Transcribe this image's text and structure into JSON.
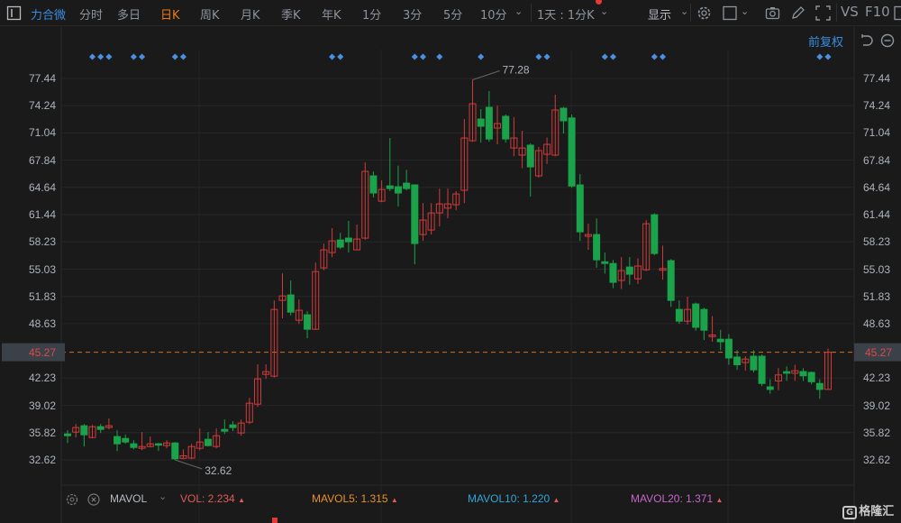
{
  "toolbar": {
    "stock_name": "力合微",
    "periods": [
      "分时",
      "多日",
      "日K",
      "周K",
      "月K",
      "季K",
      "年K",
      "1分",
      "3分",
      "5分",
      "10分"
    ],
    "active_period": "日K",
    "interval_select": "1天 : 1分K",
    "display_menu": "显示",
    "vs": "VS",
    "f10": "F10"
  },
  "sub_toolbar": {
    "adjust_mode": "前复权"
  },
  "indicator_bar": {
    "name": "MAVOL",
    "items": [
      {
        "label": "VOL: 2.234",
        "color": "#e05a5a"
      },
      {
        "label": "MAVOL5: 1.315",
        "color": "#e8902c"
      },
      {
        "label": "MAVOL10: 1.220",
        "color": "#2fa6d9"
      },
      {
        "label": "MAVOL20: 1.371",
        "color": "#c766c9"
      }
    ],
    "up_arrow": "▲"
  },
  "watermark": "格隆汇",
  "colors": {
    "accent": "#3b8de0",
    "active": "#f07a16",
    "up": "#d23a3a",
    "down": "#1aa34a",
    "current_line": "#d0702a",
    "marker": "#4a90e2"
  },
  "chart_data": {
    "type": "candlestick",
    "title": "力合微 日K",
    "y_ticks": [
      "77.44",
      "74.24",
      "71.04",
      "67.84",
      "64.64",
      "61.44",
      "58.23",
      "55.03",
      "51.83",
      "48.63",
      "42.23",
      "39.02",
      "35.82",
      "32.62"
    ],
    "ylim": [
      32.62,
      77.44
    ],
    "current_price": "45.27",
    "max_label": "77.28",
    "min_label": "32.62",
    "max_index": 49,
    "min_index": 13,
    "markers": [
      3,
      4,
      5,
      8,
      9,
      13,
      14,
      32,
      33,
      42,
      43,
      45,
      50,
      57,
      58,
      65,
      66,
      71,
      72,
      91,
      92
    ],
    "ohlc": [
      [
        35.67,
        36.1,
        34.61,
        35.46
      ],
      [
        35.89,
        36.84,
        35.25,
        36.42
      ],
      [
        36.63,
        36.84,
        34.19,
        35.57
      ],
      [
        35.25,
        36.73,
        35.15,
        36.52
      ],
      [
        36.52,
        36.84,
        35.78,
        36.2
      ],
      [
        36.42,
        37.48,
        36.2,
        36.63
      ],
      [
        35.36,
        36.1,
        33.66,
        34.51
      ],
      [
        35.14,
        35.57,
        34.51,
        34.72
      ],
      [
        34.51,
        34.93,
        33.87,
        34.08
      ],
      [
        33.98,
        35.89,
        33.76,
        34.19
      ],
      [
        34.19,
        35.36,
        34.08,
        34.51
      ],
      [
        34.51,
        34.61,
        33.66,
        34.4
      ],
      [
        34.3,
        34.93,
        33.98,
        34.61
      ],
      [
        34.61,
        34.72,
        32.62,
        32.75
      ],
      [
        32.8,
        33.87,
        32.7,
        33.1
      ],
      [
        32.83,
        34.51,
        32.7,
        34.19
      ],
      [
        33.98,
        36.31,
        33.76,
        34.72
      ],
      [
        35.04,
        35.89,
        34.19,
        34.3
      ],
      [
        34.19,
        36.31,
        33.98,
        35.46
      ],
      [
        36.2,
        37.37,
        35.67,
        35.99
      ],
      [
        36.73,
        37.16,
        36.0,
        36.42
      ],
      [
        35.78,
        37.37,
        35.46,
        36.95
      ],
      [
        37.05,
        39.91,
        36.84,
        39.28
      ],
      [
        39.17,
        43.84,
        38.85,
        42.14
      ],
      [
        42.67,
        43.84,
        42.14,
        42.99
      ],
      [
        42.46,
        51.36,
        42.3,
        50.3
      ],
      [
        51.36,
        54.54,
        49.24,
        51.89
      ],
      [
        52.0,
        53.69,
        49.6,
        49.98
      ],
      [
        49.03,
        51.47,
        48.6,
        50.2
      ],
      [
        49.67,
        50.1,
        46.91,
        47.97
      ],
      [
        47.97,
        55.81,
        47.9,
        54.75
      ],
      [
        55.18,
        58.04,
        54.9,
        57.3
      ],
      [
        56.98,
        59.84,
        56.45,
        58.36
      ],
      [
        58.46,
        59.3,
        57.4,
        57.62
      ],
      [
        58.68,
        60.7,
        57.0,
        58.25
      ],
      [
        57.3,
        60.27,
        57.3,
        58.57
      ],
      [
        58.68,
        67.58,
        58.5,
        66.52
      ],
      [
        65.99,
        66.5,
        63.45,
        63.98
      ],
      [
        63.02,
        65.46,
        62.9,
        64.4
      ],
      [
        64.82,
        70.44,
        64.2,
        64.5
      ],
      [
        64.72,
        67.2,
        62.4,
        63.98
      ],
      [
        65.14,
        66.7,
        64.3,
        64.5
      ],
      [
        64.93,
        65.0,
        55.6,
        58.04
      ],
      [
        59.1,
        62.8,
        58.36,
        60.8
      ],
      [
        59.63,
        62.8,
        59.1,
        61.64
      ],
      [
        61.64,
        64.5,
        60.05,
        62.7
      ],
      [
        62.2,
        64.5,
        61.0,
        62.7
      ],
      [
        62.6,
        64.2,
        61.96,
        63.87
      ],
      [
        64.3,
        72.67,
        62.8,
        70.44
      ],
      [
        70.12,
        77.28,
        70.0,
        74.47
      ],
      [
        72.67,
        73.84,
        69.9,
        71.82
      ],
      [
        74.05,
        75.95,
        70.0,
        70.33
      ],
      [
        71.61,
        74.26,
        69.7,
        72.14
      ],
      [
        72.99,
        73.2,
        69.9,
        70.33
      ],
      [
        69.27,
        72.9,
        68.3,
        70.44
      ],
      [
        68.43,
        71.3,
        66.9,
        69.27
      ],
      [
        69.6,
        69.8,
        63.55,
        67.05
      ],
      [
        65.99,
        69.4,
        65.8,
        68.96
      ],
      [
        68.53,
        70.5,
        67.4,
        69.7
      ],
      [
        68.43,
        75.53,
        68.3,
        73.73
      ],
      [
        73.94,
        74.1,
        70.97,
        72.46
      ],
      [
        72.8,
        73.2,
        64.6,
        64.8
      ],
      [
        64.93,
        66.2,
        58.36,
        59.42
      ],
      [
        58.89,
        60.37,
        57.3,
        59.1
      ],
      [
        59.1,
        61.0,
        55.2,
        56.13
      ],
      [
        55.9,
        56.98,
        54.5,
        55.7
      ],
      [
        55.7,
        56.1,
        52.8,
        53.48
      ],
      [
        53.7,
        56.45,
        52.7,
        54.86
      ],
      [
        55.28,
        56.45,
        53.2,
        54.44
      ],
      [
        53.9,
        56.3,
        53.3,
        55.4
      ],
      [
        54.96,
        60.8,
        54.8,
        60.37
      ],
      [
        61.43,
        61.6,
        56.66,
        56.87
      ],
      [
        54.9,
        57.8,
        53.8,
        55.1
      ],
      [
        56.03,
        56.2,
        50.6,
        51.36
      ],
      [
        50.3,
        51.36,
        48.6,
        48.92
      ],
      [
        48.92,
        51.8,
        48.5,
        50.3
      ],
      [
        50.94,
        51.1,
        47.8,
        48.2
      ],
      [
        50.3,
        50.5,
        46.7,
        47.86
      ],
      [
        47.1,
        49.5,
        46.5,
        47.3
      ],
      [
        46.8,
        47.9,
        45.5,
        46.5
      ],
      [
        46.8,
        47.4,
        43.8,
        44.6
      ],
      [
        44.7,
        45.5,
        43.2,
        43.8
      ],
      [
        44.05,
        44.8,
        43.1,
        44.47
      ],
      [
        44.8,
        45.5,
        42.9,
        43.2
      ],
      [
        44.8,
        45.0,
        41.3,
        41.6
      ],
      [
        41.2,
        42.1,
        40.4,
        40.9
      ],
      [
        41.9,
        43.4,
        40.8,
        42.6
      ],
      [
        42.99,
        43.6,
        41.9,
        42.8
      ],
      [
        42.8,
        43.8,
        41.9,
        43.1
      ],
      [
        43.0,
        43.4,
        41.9,
        42.5
      ],
      [
        42.9,
        43.0,
        41.5,
        41.8
      ],
      [
        41.6,
        42.1,
        39.8,
        40.9
      ],
      [
        40.9,
        45.7,
        40.9,
        45.27
      ]
    ]
  }
}
